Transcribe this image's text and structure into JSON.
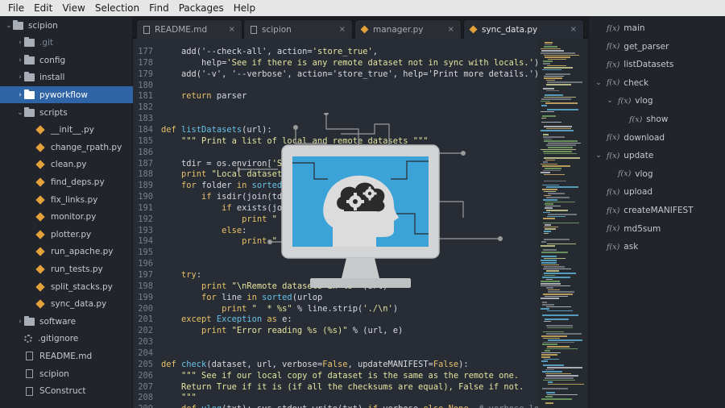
{
  "menu": [
    "File",
    "Edit",
    "View",
    "Selection",
    "Find",
    "Packages",
    "Help"
  ],
  "tree": [
    {
      "label": "scipion",
      "type": "folder-open",
      "indent": 0,
      "chevron": "⌄"
    },
    {
      "label": ".git",
      "type": "folder",
      "indent": 1,
      "chevron": "›",
      "dim": true
    },
    {
      "label": "config",
      "type": "folder",
      "indent": 1,
      "chevron": "›"
    },
    {
      "label": "install",
      "type": "folder",
      "indent": 1,
      "chevron": "›"
    },
    {
      "label": "pyworkflow",
      "type": "folder",
      "indent": 1,
      "chevron": "›",
      "selected": true
    },
    {
      "label": "scripts",
      "type": "folder",
      "indent": 1,
      "chevron": "⌄"
    },
    {
      "label": "__init__.py",
      "type": "py",
      "indent": 2
    },
    {
      "label": "change_rpath.py",
      "type": "py",
      "indent": 2
    },
    {
      "label": "clean.py",
      "type": "py",
      "indent": 2
    },
    {
      "label": "find_deps.py",
      "type": "py",
      "indent": 2
    },
    {
      "label": "fix_links.py",
      "type": "py",
      "indent": 2
    },
    {
      "label": "monitor.py",
      "type": "py",
      "indent": 2
    },
    {
      "label": "plotter.py",
      "type": "py",
      "indent": 2
    },
    {
      "label": "run_apache.py",
      "type": "py",
      "indent": 2
    },
    {
      "label": "run_tests.py",
      "type": "py",
      "indent": 2
    },
    {
      "label": "split_stacks.py",
      "type": "py",
      "indent": 2
    },
    {
      "label": "sync_data.py",
      "type": "py",
      "indent": 2
    },
    {
      "label": "software",
      "type": "folder",
      "indent": 1,
      "chevron": "›"
    },
    {
      "label": ".gitignore",
      "type": "gear",
      "indent": 1
    },
    {
      "label": "README.md",
      "type": "file",
      "indent": 1
    },
    {
      "label": "scipion",
      "type": "file",
      "indent": 1
    },
    {
      "label": "SConstruct",
      "type": "file",
      "indent": 1
    }
  ],
  "tabs": [
    {
      "label": "README.md",
      "icon": "file",
      "active": false
    },
    {
      "label": "scipion",
      "icon": "file",
      "active": false
    },
    {
      "label": "manager.py",
      "icon": "py",
      "active": false
    },
    {
      "label": "sync_data.py",
      "icon": "py",
      "active": true
    }
  ],
  "tab_close": "×",
  "code": [
    {
      "n": "177",
      "t": [
        [
          "    ",
          ""
        ],
        [
          "add('--check-all', action=",
          "bi"
        ],
        [
          "'store_true'",
          "str"
        ],
        [
          ",",
          "bi"
        ]
      ]
    },
    {
      "n": "178",
      "t": [
        [
          "        ",
          ""
        ],
        [
          "help=",
          "bi"
        ],
        [
          "'See if there is any remote dataset not in sync with locals.'",
          "str"
        ],
        [
          ")",
          "bi"
        ]
      ]
    },
    {
      "n": "179",
      "t": [
        [
          "    ",
          ""
        ],
        [
          "add('-v', '--verbose', action='store_true', help='Print more details.')",
          "bi"
        ]
      ]
    },
    {
      "n": "180",
      "t": []
    },
    {
      "n": "181",
      "t": [
        [
          "    ",
          ""
        ],
        [
          "return",
          "kw"
        ],
        [
          " parser",
          "bi"
        ]
      ]
    },
    {
      "n": "182",
      "t": []
    },
    {
      "n": "183",
      "t": []
    },
    {
      "n": "184",
      "t": [
        [
          "def ",
          "kw"
        ],
        [
          "listDatasets",
          "fn"
        ],
        [
          "(url):",
          "bi"
        ]
      ]
    },
    {
      "n": "185",
      "t": [
        [
          "    ",
          ""
        ],
        [
          "\"\"\" Print a list of local and remote datasets \"\"\"",
          "str"
        ]
      ]
    },
    {
      "n": "186",
      "t": []
    },
    {
      "n": "187",
      "t": [
        [
          "    ",
          ""
        ],
        [
          "tdir = os.environ[",
          "bi"
        ],
        [
          "'SCIP",
          "str"
        ]
      ]
    },
    {
      "n": "188",
      "t": [
        [
          "    ",
          ""
        ],
        [
          "print ",
          "kw"
        ],
        [
          "\"Local datasets i",
          "str"
        ]
      ]
    },
    {
      "n": "189",
      "t": [
        [
          "    ",
          ""
        ],
        [
          "for ",
          "kw"
        ],
        [
          "folder ",
          "bi"
        ],
        [
          "in ",
          "kw"
        ],
        [
          "sorted",
          "fn"
        ],
        [
          "(os",
          "bi"
        ]
      ]
    },
    {
      "n": "190",
      "t": [
        [
          "        ",
          ""
        ],
        [
          "if ",
          "kw"
        ],
        [
          "isdir(join(tdir,",
          "bi"
        ]
      ]
    },
    {
      "n": "191",
      "t": [
        [
          "            ",
          ""
        ],
        [
          "if ",
          "kw"
        ],
        [
          "exists(join(",
          "bi"
        ]
      ]
    },
    {
      "n": "192",
      "t": [
        [
          "                ",
          ""
        ],
        [
          "print ",
          "kw"
        ],
        [
          "\"  *",
          "str"
        ]
      ]
    },
    {
      "n": "193",
      "t": [
        [
          "            ",
          ""
        ],
        [
          "else",
          "kw"
        ],
        [
          ":",
          "bi"
        ]
      ]
    },
    {
      "n": "194",
      "t": [
        [
          "                ",
          ""
        ],
        [
          "print ",
          "kw"
        ],
        [
          "\"  *",
          "str"
        ]
      ]
    },
    {
      "n": "195",
      "t": []
    },
    {
      "n": "196",
      "t": []
    },
    {
      "n": "197",
      "t": [
        [
          "    ",
          ""
        ],
        [
          "try",
          "kw"
        ],
        [
          ":",
          "bi"
        ]
      ]
    },
    {
      "n": "198",
      "t": [
        [
          "        ",
          ""
        ],
        [
          "print ",
          "kw"
        ],
        [
          "\"\\nRemote datasets in %s\"",
          "str"
        ]
      ]
    },
    {
      "n": "199",
      "t": [
        [
          "        ",
          ""
        ],
        [
          "for ",
          "kw"
        ],
        [
          "line ",
          "bi"
        ],
        [
          "in ",
          "kw"
        ],
        [
          "sorted",
          "fn"
        ],
        [
          "(urlop",
          "bi"
        ]
      ]
    },
    {
      "n": "200",
      "t": [
        [
          "            ",
          ""
        ],
        [
          "print ",
          "kw"
        ],
        [
          "\"  * %s\"",
          "str"
        ],
        [
          " % line.strip(",
          "bi"
        ],
        [
          "'./\\n'",
          "str"
        ],
        [
          ")",
          "bi"
        ]
      ]
    },
    {
      "n": "201",
      "t": [
        [
          "    ",
          ""
        ],
        [
          "except ",
          "kw"
        ],
        [
          "Exception ",
          "fn"
        ],
        [
          "as ",
          "kw"
        ],
        [
          "e:",
          "bi"
        ]
      ]
    },
    {
      "n": "202",
      "t": [
        [
          "        ",
          ""
        ],
        [
          "print ",
          "kw"
        ],
        [
          "\"Error reading %s (%s)\"",
          "str"
        ],
        [
          " % (url, e)",
          "bi"
        ]
      ]
    },
    {
      "n": "203",
      "t": []
    },
    {
      "n": "204",
      "t": []
    },
    {
      "n": "205",
      "t": [
        [
          "def ",
          "kw"
        ],
        [
          "check",
          "fn"
        ],
        [
          "(dataset, url, verbose=",
          "bi"
        ],
        [
          "False",
          "kw"
        ],
        [
          ", updateMANIFEST=",
          "bi"
        ],
        [
          "False",
          "kw"
        ],
        [
          "):",
          "bi"
        ]
      ]
    },
    {
      "n": "206",
      "t": [
        [
          "    ",
          ""
        ],
        [
          "\"\"\" See if our local copy of dataset is the same as the remote one.",
          "str"
        ]
      ]
    },
    {
      "n": "207",
      "t": [
        [
          "    ",
          ""
        ],
        [
          "Return True if it is (if all the checksums are equal), False if not.",
          "str"
        ]
      ]
    },
    {
      "n": "208",
      "t": [
        [
          "    ",
          ""
        ],
        [
          "\"\"\"",
          "str"
        ]
      ]
    },
    {
      "n": "209",
      "t": [
        [
          "    ",
          ""
        ],
        [
          "def ",
          "kw"
        ],
        [
          "vlog",
          "fn"
        ],
        [
          "(txt): sys.stdout.write(txt) ",
          "bi"
        ],
        [
          "if ",
          "kw"
        ],
        [
          "verbose ",
          "bi"
        ],
        [
          "else ",
          "kw"
        ],
        [
          "None  ",
          "kw"
        ],
        [
          "# verbose log",
          "cm"
        ]
      ]
    }
  ],
  "code_partial_right": [
    {
      "n": "187",
      "text": ""
    },
    {
      "n": "198",
      "text": "(url)"
    },
    {
      "n": "194",
      "text": "der"
    }
  ],
  "symbols": [
    {
      "label": "main",
      "indent": 0
    },
    {
      "label": "get_parser",
      "indent": 0
    },
    {
      "label": "listDatasets",
      "indent": 0
    },
    {
      "label": "check",
      "indent": 0,
      "chevron": "⌄"
    },
    {
      "label": "vlog",
      "indent": 1,
      "chevron": "⌄"
    },
    {
      "label": "show",
      "indent": 2
    },
    {
      "label": "download",
      "indent": 0
    },
    {
      "label": "update",
      "indent": 0,
      "chevron": "⌄"
    },
    {
      "label": "vlog",
      "indent": 1
    },
    {
      "label": "upload",
      "indent": 0
    },
    {
      "label": "createMANIFEST",
      "indent": 0
    },
    {
      "label": "md5sum",
      "indent": 0
    },
    {
      "label": "ask",
      "indent": 0
    }
  ],
  "symbol_prefix": "f(x)",
  "colors": {
    "accent": "#2f64a6",
    "monitor_screen": "#3ba3d8",
    "monitor_frame": "#d2d4d6",
    "head": "#dcdcdc",
    "gear": "#2b2b2b"
  },
  "icons": {
    "overlay": "monitor-brain-gears-icon"
  }
}
